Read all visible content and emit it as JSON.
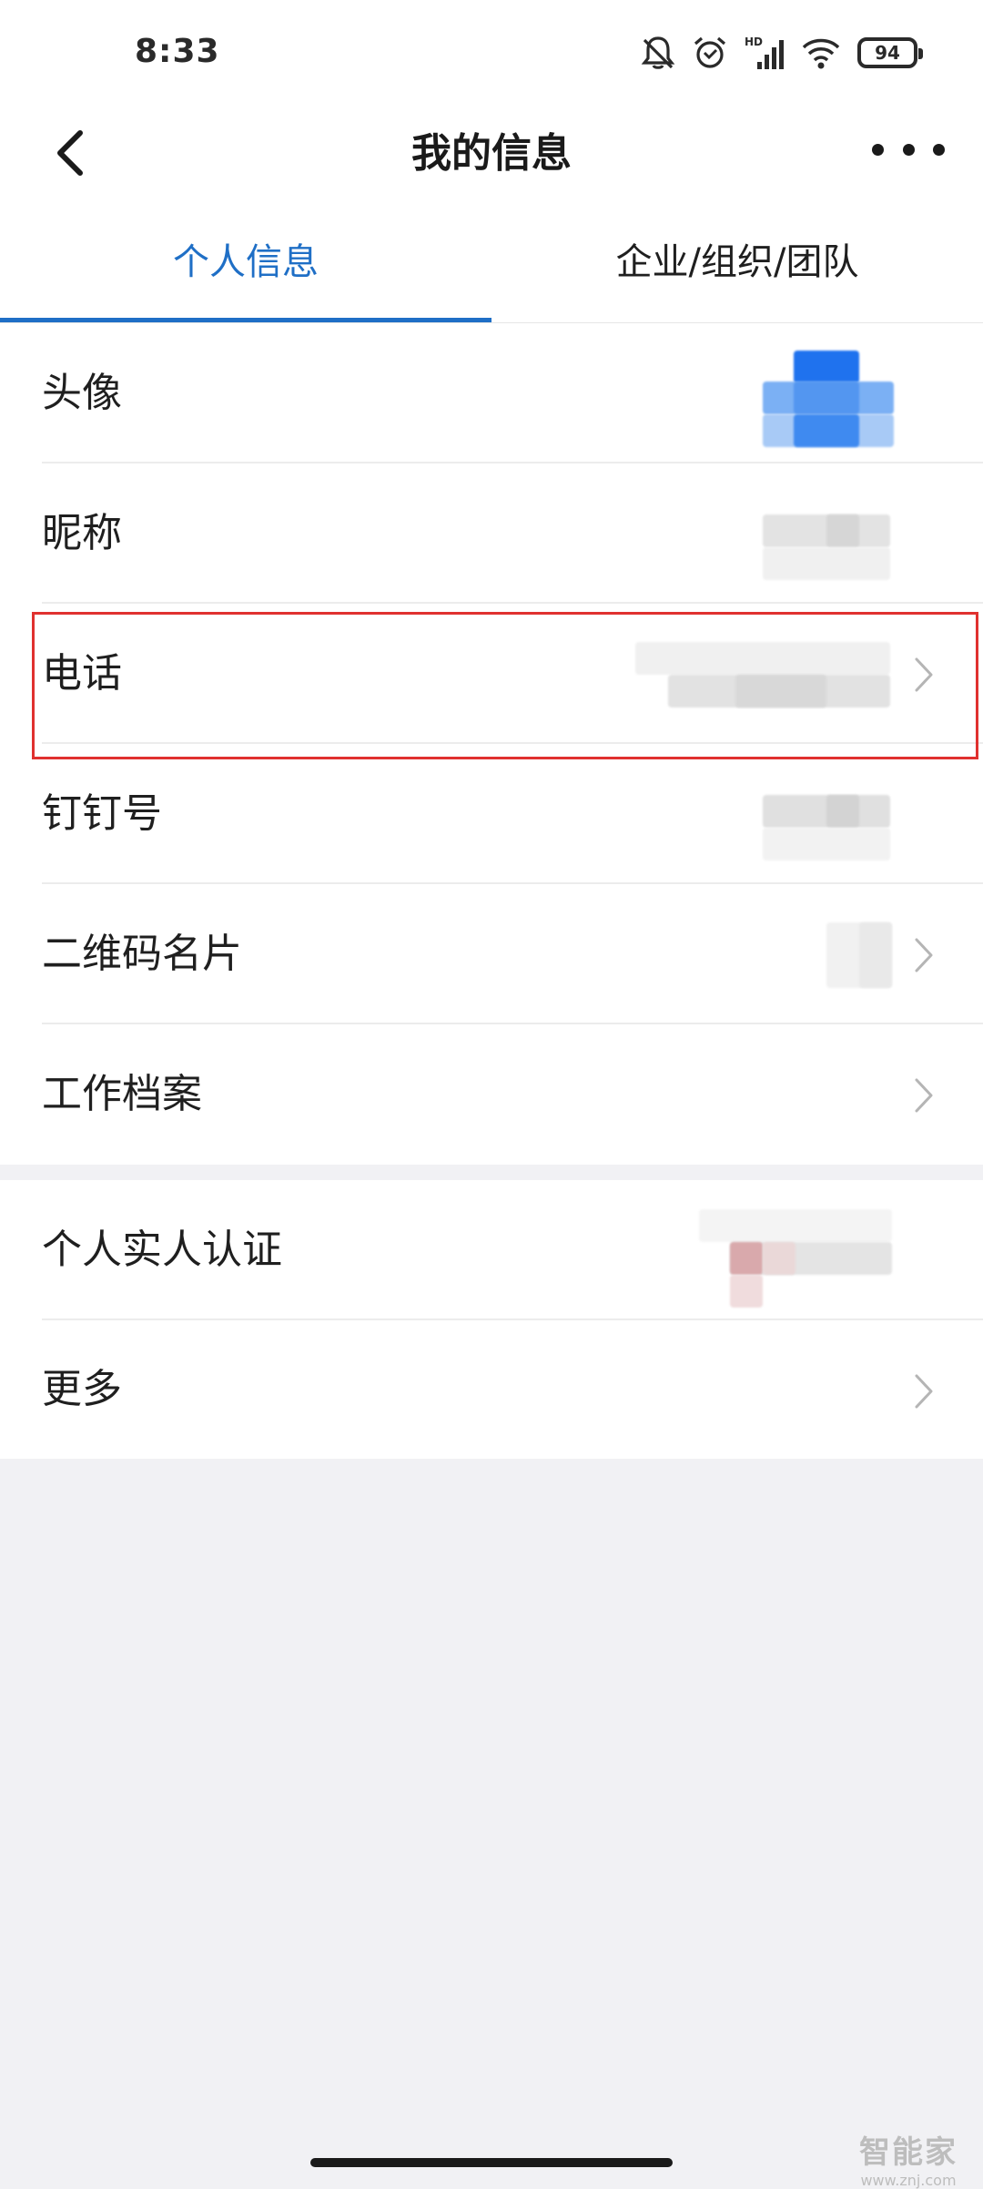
{
  "status_bar": {
    "time": "8:33",
    "battery": "94",
    "icons": [
      "bell-off-icon",
      "alarm-icon",
      "hd-signal-icon",
      "wifi-icon",
      "battery-icon"
    ]
  },
  "nav": {
    "title": "我的信息",
    "back_icon": "chevron-left-icon",
    "more_icon": "more-horizontal-icon"
  },
  "tabs": [
    {
      "label": "个人信息",
      "active": true
    },
    {
      "label": "企业/组织/团队",
      "active": false
    }
  ],
  "section_1": [
    {
      "label": "头像",
      "value": "blurred-avatar"
    },
    {
      "label": "昵称",
      "value": "blurred"
    },
    {
      "label": "电话",
      "value": "blurred",
      "highlighted": true
    },
    {
      "label": "钉钉号",
      "value": "blurred"
    },
    {
      "label": "二维码名片",
      "value": "blurred"
    },
    {
      "label": "工作档案"
    }
  ],
  "section_2": [
    {
      "label": "个人实人认证",
      "value": "blurred"
    },
    {
      "label": "更多"
    }
  ],
  "colors": {
    "accent": "#1f6fc6",
    "highlight_border": "#e0312f",
    "background": "#f1f1f4"
  },
  "watermark": {
    "logo": "智能家",
    "url": "www.znj.com"
  }
}
